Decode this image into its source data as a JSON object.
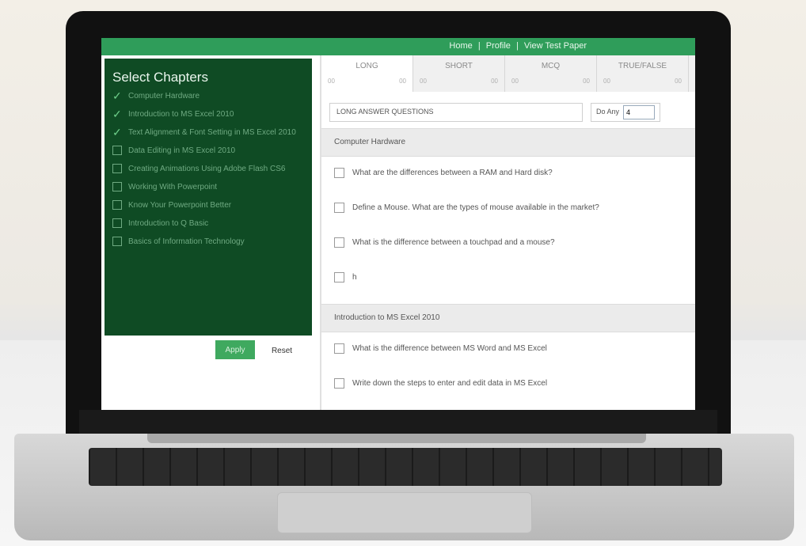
{
  "nav": {
    "links": [
      "Home",
      "Profile",
      "View Test Paper"
    ],
    "separator": "|"
  },
  "sidebar": {
    "title": "Select Chapters",
    "chapters": [
      {
        "label": "Computer Hardware",
        "checked": true
      },
      {
        "label": "Introduction to MS Excel 2010",
        "checked": true
      },
      {
        "label": "Text Alignment & Font Setting in MS Excel 2010",
        "checked": true
      },
      {
        "label": "Data Editing in MS Excel 2010",
        "checked": false
      },
      {
        "label": "Creating Animations Using Adobe Flash CS6",
        "checked": false
      },
      {
        "label": "Working With Powerpoint",
        "checked": false
      },
      {
        "label": "Know Your Powerpoint Better",
        "checked": false
      },
      {
        "label": "Introduction to Q Basic",
        "checked": false
      },
      {
        "label": "Basics of Information Technology",
        "checked": false
      }
    ],
    "apply_label": "Apply",
    "reset_label": "Reset"
  },
  "tabs": [
    {
      "label": "LONG",
      "sub": [
        "00",
        "00"
      ]
    },
    {
      "label": "SHORT",
      "sub": [
        "00",
        "00"
      ]
    },
    {
      "label": "MCQ",
      "sub": [
        "00",
        "00"
      ]
    },
    {
      "label": "TRUE/FALSE",
      "sub": [
        "00",
        "00"
      ]
    }
  ],
  "question_type": {
    "value": "LONG ANSWER QUESTIONS",
    "do_any_label": "Do Any",
    "do_any_value": "4"
  },
  "sections": [
    {
      "title": "Computer Hardware",
      "questions": [
        "What are the differences between a RAM and Hard disk?",
        "Define a Mouse. What are the types of mouse available in the market?",
        "What is the difference between a touchpad and a mouse?",
        "h"
      ]
    },
    {
      "title": "Introduction to MS Excel 2010",
      "questions": [
        "What is the difference between MS Word and MS Excel",
        "Write down the steps to enter and edit data in MS Excel"
      ]
    }
  ],
  "colors": {
    "topbar": "#2f9d5a",
    "sidebar": "#0f4b24",
    "apply": "#3fa95f"
  }
}
